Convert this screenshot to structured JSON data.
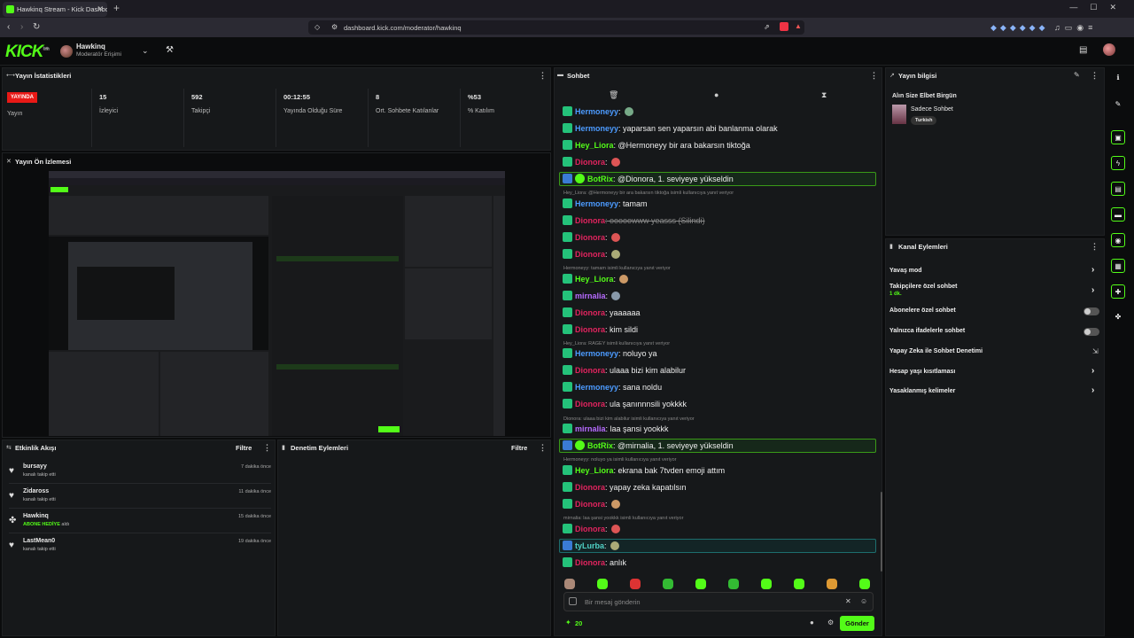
{
  "browser": {
    "tab_title": "Hawkinq Stream - Kick Dashboard",
    "url": "dashboard.kick.com/moderator/hawkinq"
  },
  "header": {
    "logo": "KICK",
    "logo_sup": "beta",
    "username": "Hawkinq",
    "role": "Moderatör Erişimi"
  },
  "stats": {
    "title": "Yayın İstatistikleri",
    "live_badge": "YAYINDA",
    "items": [
      {
        "value": "",
        "label": "Yayın"
      },
      {
        "value": "15",
        "label": "İzleyici"
      },
      {
        "value": "592",
        "label": "Takipçi"
      },
      {
        "value": "00:12:55",
        "label": "Yayında Olduğu Süre"
      },
      {
        "value": "8",
        "label": "Ort. Sohbete Katılanlar"
      },
      {
        "value": "%53",
        "label": "% Katılım"
      }
    ]
  },
  "preview": {
    "title": "Yayın Ön İzlemesi"
  },
  "feed": {
    "title": "Etkinlik Akışı",
    "filter": "Filtre",
    "items": [
      {
        "name": "bursayy",
        "desc": "kanalı takip etti",
        "time": "7 dakika önce",
        "icon": "heart-icon"
      },
      {
        "name": "Zidaross",
        "desc": "kanalı takip etti",
        "time": "11 dakika önce",
        "icon": "heart-icon"
      },
      {
        "name": "Hawkinq",
        "desc": "ABONE HEDİYE",
        "desc2": "aldı",
        "time": "15 dakika önce",
        "icon": "gift-icon"
      },
      {
        "name": "LastMean0",
        "desc": "kanalı takip etti",
        "time": "19 dakika önce",
        "icon": "heart-icon"
      }
    ]
  },
  "mod_actions": {
    "title": "Denetim Eylemleri",
    "filter": "Filtre"
  },
  "chat": {
    "title": "Sohbet",
    "placeholder": "Bir mesaj gönderin",
    "points": "20",
    "send": "Gönder",
    "messages": [
      {
        "user": "Hermoneyy",
        "color": "#4c9bff",
        "text": ":",
        "emote": true
      },
      {
        "user": "Hermoneyy",
        "color": "#4c9bff",
        "text": ": yaparsan sen yaparsın abi banlanma olarak"
      },
      {
        "user": "Hey_Liora",
        "color": "#53fc18",
        "text": ": @Hermoneyy bir ara bakarsın tiktoğa"
      },
      {
        "user": "Dionora",
        "color": "#e0245e",
        "text": ":",
        "emote": true
      },
      {
        "user": "BotRix",
        "color": "#53fc18",
        "text": ": @Dionora, 1. seviyeye yükseldin",
        "highlight": "green"
      },
      {
        "reply": "Hey_Liora: @Hermoneyy bir ara bakarsın tiktoğa isimli kullanıcıya yanıt veriyor"
      },
      {
        "user": "Hermoneyy",
        "color": "#4c9bff",
        "text": ": tamam"
      },
      {
        "user": "Dionora",
        "color": "#e0245e",
        "text": ": ooooowww yeasss (Silindi)",
        "deleted": true
      },
      {
        "user": "Dionora",
        "color": "#e0245e",
        "text": ":",
        "emote": true
      },
      {
        "user": "Dionora",
        "color": "#e0245e",
        "text": ":",
        "emote": true
      },
      {
        "reply": "Hermoneyy: tamam isimli kullanıcıya yanıt veriyor"
      },
      {
        "user": "Hey_Liora",
        "color": "#53fc18",
        "text": ":",
        "emote": true
      },
      {
        "user": "mirnalia",
        "color": "#b66bff",
        "text": ":",
        "emote": true
      },
      {
        "user": "Dionora",
        "color": "#e0245e",
        "text": ": yaaaaaa"
      },
      {
        "user": "Dionora",
        "color": "#e0245e",
        "text": ": kim sildi"
      },
      {
        "reply": "Hey_Liora: RAGEY isimli kullanıcıya yanıt veriyor"
      },
      {
        "user": "Hermoneyy",
        "color": "#4c9bff",
        "text": ": noluyo ya"
      },
      {
        "user": "Dionora",
        "color": "#e0245e",
        "text": ": ulaaa bizi kim alabilur"
      },
      {
        "user": "Hermoneyy",
        "color": "#4c9bff",
        "text": ": sana noldu"
      },
      {
        "user": "Dionora",
        "color": "#e0245e",
        "text": ": ula şanınnnsili yokkkk"
      },
      {
        "reply": "Dionora: ulaaa bizi kim alabilur isimli kullanıcıya yanıt veriyor"
      },
      {
        "user": "mirnalia",
        "color": "#b66bff",
        "text": ": laa şansi yookkk"
      },
      {
        "user": "BotRix",
        "color": "#53fc18",
        "text": ": @mirnalia, 1. seviyeye yükseldin",
        "highlight": "green"
      },
      {
        "reply": "Hermoneyy: noluyo ya isimli kullanıcıya yanıt veriyor"
      },
      {
        "user": "Hey_Liora",
        "color": "#53fc18",
        "text": ": ekrana bak 7tvden emoji attım"
      },
      {
        "user": "Dionora",
        "color": "#e0245e",
        "text": ": yapay zeka kapatılsın"
      },
      {
        "user": "Dionora",
        "color": "#e0245e",
        "text": ":",
        "emote": true
      },
      {
        "reply": "mirnalia: laa şansi yookkk isimli kullanıcıya yanıt veriyor"
      },
      {
        "user": "Dionora",
        "color": "#e0245e",
        "text": ":",
        "emote": true
      },
      {
        "user": "tyLurba",
        "color": "#4fd1c5",
        "text": ":",
        "emote": true,
        "highlight": "teal"
      },
      {
        "user": "Dionora",
        "color": "#e0245e",
        "text": ": anlık"
      }
    ]
  },
  "stream_info": {
    "title": "Yayın bilgisi",
    "stream_title": "Alın Size Elbet Birgün",
    "category": "Sadece Sohbet",
    "language": "Turkish"
  },
  "channel_actions": {
    "title": "Kanal Eylemleri",
    "items": [
      {
        "label": "Yavaş mod",
        "sub": "",
        "control": "chevron"
      },
      {
        "label": "Takipçilere özel sohbet",
        "sub": "1 dk.",
        "control": "chevron"
      },
      {
        "label": "Abonelere özel sohbet",
        "sub": "",
        "control": "toggle"
      },
      {
        "label": "Yalnızca ifadelerle sohbet",
        "sub": "",
        "control": "toggle"
      },
      {
        "label": "Yapay Zeka ile Sohbet Denetimi",
        "sub": "",
        "control": "external"
      },
      {
        "label": "Hesap yaşı kısıtlaması",
        "sub": "",
        "control": "chevron"
      },
      {
        "label": "Yasaklanmış kelimeler",
        "sub": "",
        "control": "chevron"
      }
    ]
  },
  "colors": {
    "accent": "#53fc18",
    "live": "#e91916",
    "panel": "#16181a"
  }
}
